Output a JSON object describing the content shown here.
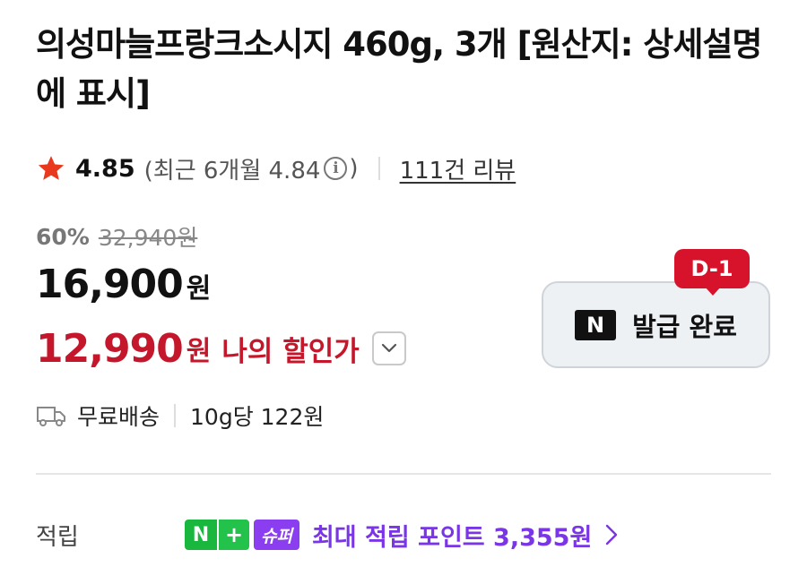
{
  "product": {
    "title": "의성마늘프랑크소시지 460g, 3개 [원산지: 상세설명에 표시]"
  },
  "rating": {
    "score": "4.85",
    "recent_prefix": "(최근 6개월 4.84",
    "recent_suffix": ")",
    "info_glyph": "i",
    "review_link": "111건 리뷰",
    "star_color": "#e8391f"
  },
  "price": {
    "discount_rate": "60%",
    "original_price": "32,940원",
    "sale_amount": "16,900",
    "sale_unit": "원",
    "my_amount": "12,990",
    "my_unit": "원",
    "my_label": "나의 할인가",
    "accent_color": "#c5172b"
  },
  "coupon": {
    "dday": "D-1",
    "badge_letter": "N",
    "label": "발급 완료"
  },
  "shipping": {
    "method": "무료배송",
    "unit_price": "10g당 122원"
  },
  "points": {
    "label": "적립",
    "badge_n": "N",
    "badge_plus": "+",
    "badge_super": "슈퍼",
    "text": "최대 적립 포인트 3,355원",
    "accent_color": "#7a36e6"
  },
  "icons": {
    "star": "star-icon",
    "info": "info-icon",
    "chevron_down": "chevron-down-icon",
    "naver": "naver-icon",
    "truck": "truck-icon",
    "chevron_right": "chevron-right-icon"
  }
}
